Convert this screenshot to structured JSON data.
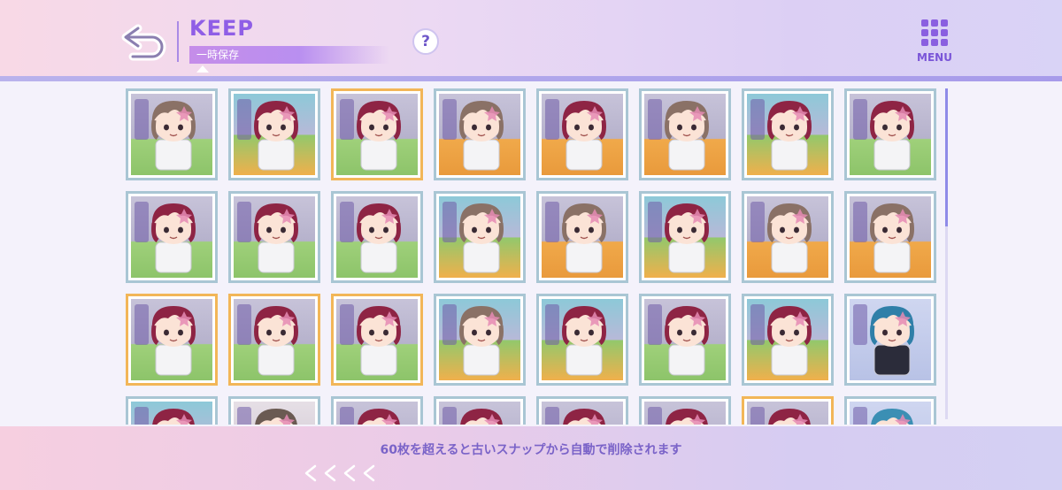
{
  "header": {
    "title": "KEEP",
    "subtitle": "一時保存",
    "help_label": "?",
    "menu_label": "MENU"
  },
  "footer": {
    "notice": "60枚を超えると古いスナップから自動で削除されます"
  },
  "colors": {
    "accent": "#8f5ee6",
    "tile_border": "#a9c6d4",
    "tile_selected_border": "#f2b658"
  },
  "snapshots": {
    "columns": 8,
    "visible_rows": 4,
    "scroll_position": 0,
    "items": [
      {
        "character": "brown-hair-white-coat",
        "scene": "shelf",
        "selected": false
      },
      {
        "character": "crimson-hair",
        "scene": "arcade-machine",
        "selected": false
      },
      {
        "character": "crimson-hair",
        "scene": "shelf",
        "selected": true
      },
      {
        "character": "brown-hair-white-coat",
        "scene": "gift-box",
        "selected": false
      },
      {
        "character": "crimson-hair",
        "scene": "gift-box",
        "selected": false
      },
      {
        "character": "brown-hair-white-coat",
        "scene": "gift-box",
        "selected": false
      },
      {
        "character": "crimson-hair",
        "scene": "arcade-machine",
        "selected": false
      },
      {
        "character": "crimson-hair",
        "scene": "shelf",
        "selected": false
      },
      {
        "character": "crimson-hair",
        "scene": "shelf",
        "selected": false
      },
      {
        "character": "crimson-hair",
        "scene": "shelf",
        "selected": false
      },
      {
        "character": "crimson-hair",
        "scene": "shelf",
        "selected": false
      },
      {
        "character": "brown-hair-white-coat",
        "scene": "arcade-machine",
        "selected": false
      },
      {
        "character": "brown-hair-white-coat",
        "scene": "gift-box",
        "selected": false
      },
      {
        "character": "crimson-hair",
        "scene": "arcade-machine",
        "selected": false
      },
      {
        "character": "brown-hair-white-coat",
        "scene": "gift-box",
        "selected": false
      },
      {
        "character": "brown-hair-white-coat",
        "scene": "gift-box",
        "selected": false
      },
      {
        "character": "crimson-hair",
        "scene": "shelf",
        "selected": true
      },
      {
        "character": "crimson-hair",
        "scene": "shelf",
        "selected": true
      },
      {
        "character": "crimson-hair",
        "scene": "shelf",
        "selected": true
      },
      {
        "character": "brown-hair-white-coat",
        "scene": "arcade-machine",
        "selected": false
      },
      {
        "character": "crimson-hair",
        "scene": "arcade-machine",
        "selected": false
      },
      {
        "character": "crimson-hair",
        "scene": "shelf",
        "selected": false
      },
      {
        "character": "crimson-hair",
        "scene": "arcade-machine",
        "selected": false
      },
      {
        "character": "blue-hair-dark-outfit",
        "scene": "cards",
        "selected": false
      },
      {
        "character": "crimson-hair",
        "scene": "arcade-machine",
        "selected": false
      },
      {
        "character": "other",
        "scene": "wheel",
        "selected": false
      },
      {
        "character": "crimson-hair",
        "scene": "shelf",
        "selected": false
      },
      {
        "character": "crimson-hair",
        "scene": "shelf",
        "selected": false
      },
      {
        "character": "crimson-hair",
        "scene": "shelf",
        "selected": false
      },
      {
        "character": "crimson-hair",
        "scene": "shelf",
        "selected": false
      },
      {
        "character": "crimson-hair",
        "scene": "shelf",
        "selected": true
      },
      {
        "character": "blue-and-crimson-hair",
        "scene": "cards",
        "selected": false
      }
    ]
  },
  "icons": {
    "back": "back-arrow-icon",
    "help": "question-icon",
    "menu": "grid-menu-icon",
    "page_left": "chevrons-left-icon"
  }
}
